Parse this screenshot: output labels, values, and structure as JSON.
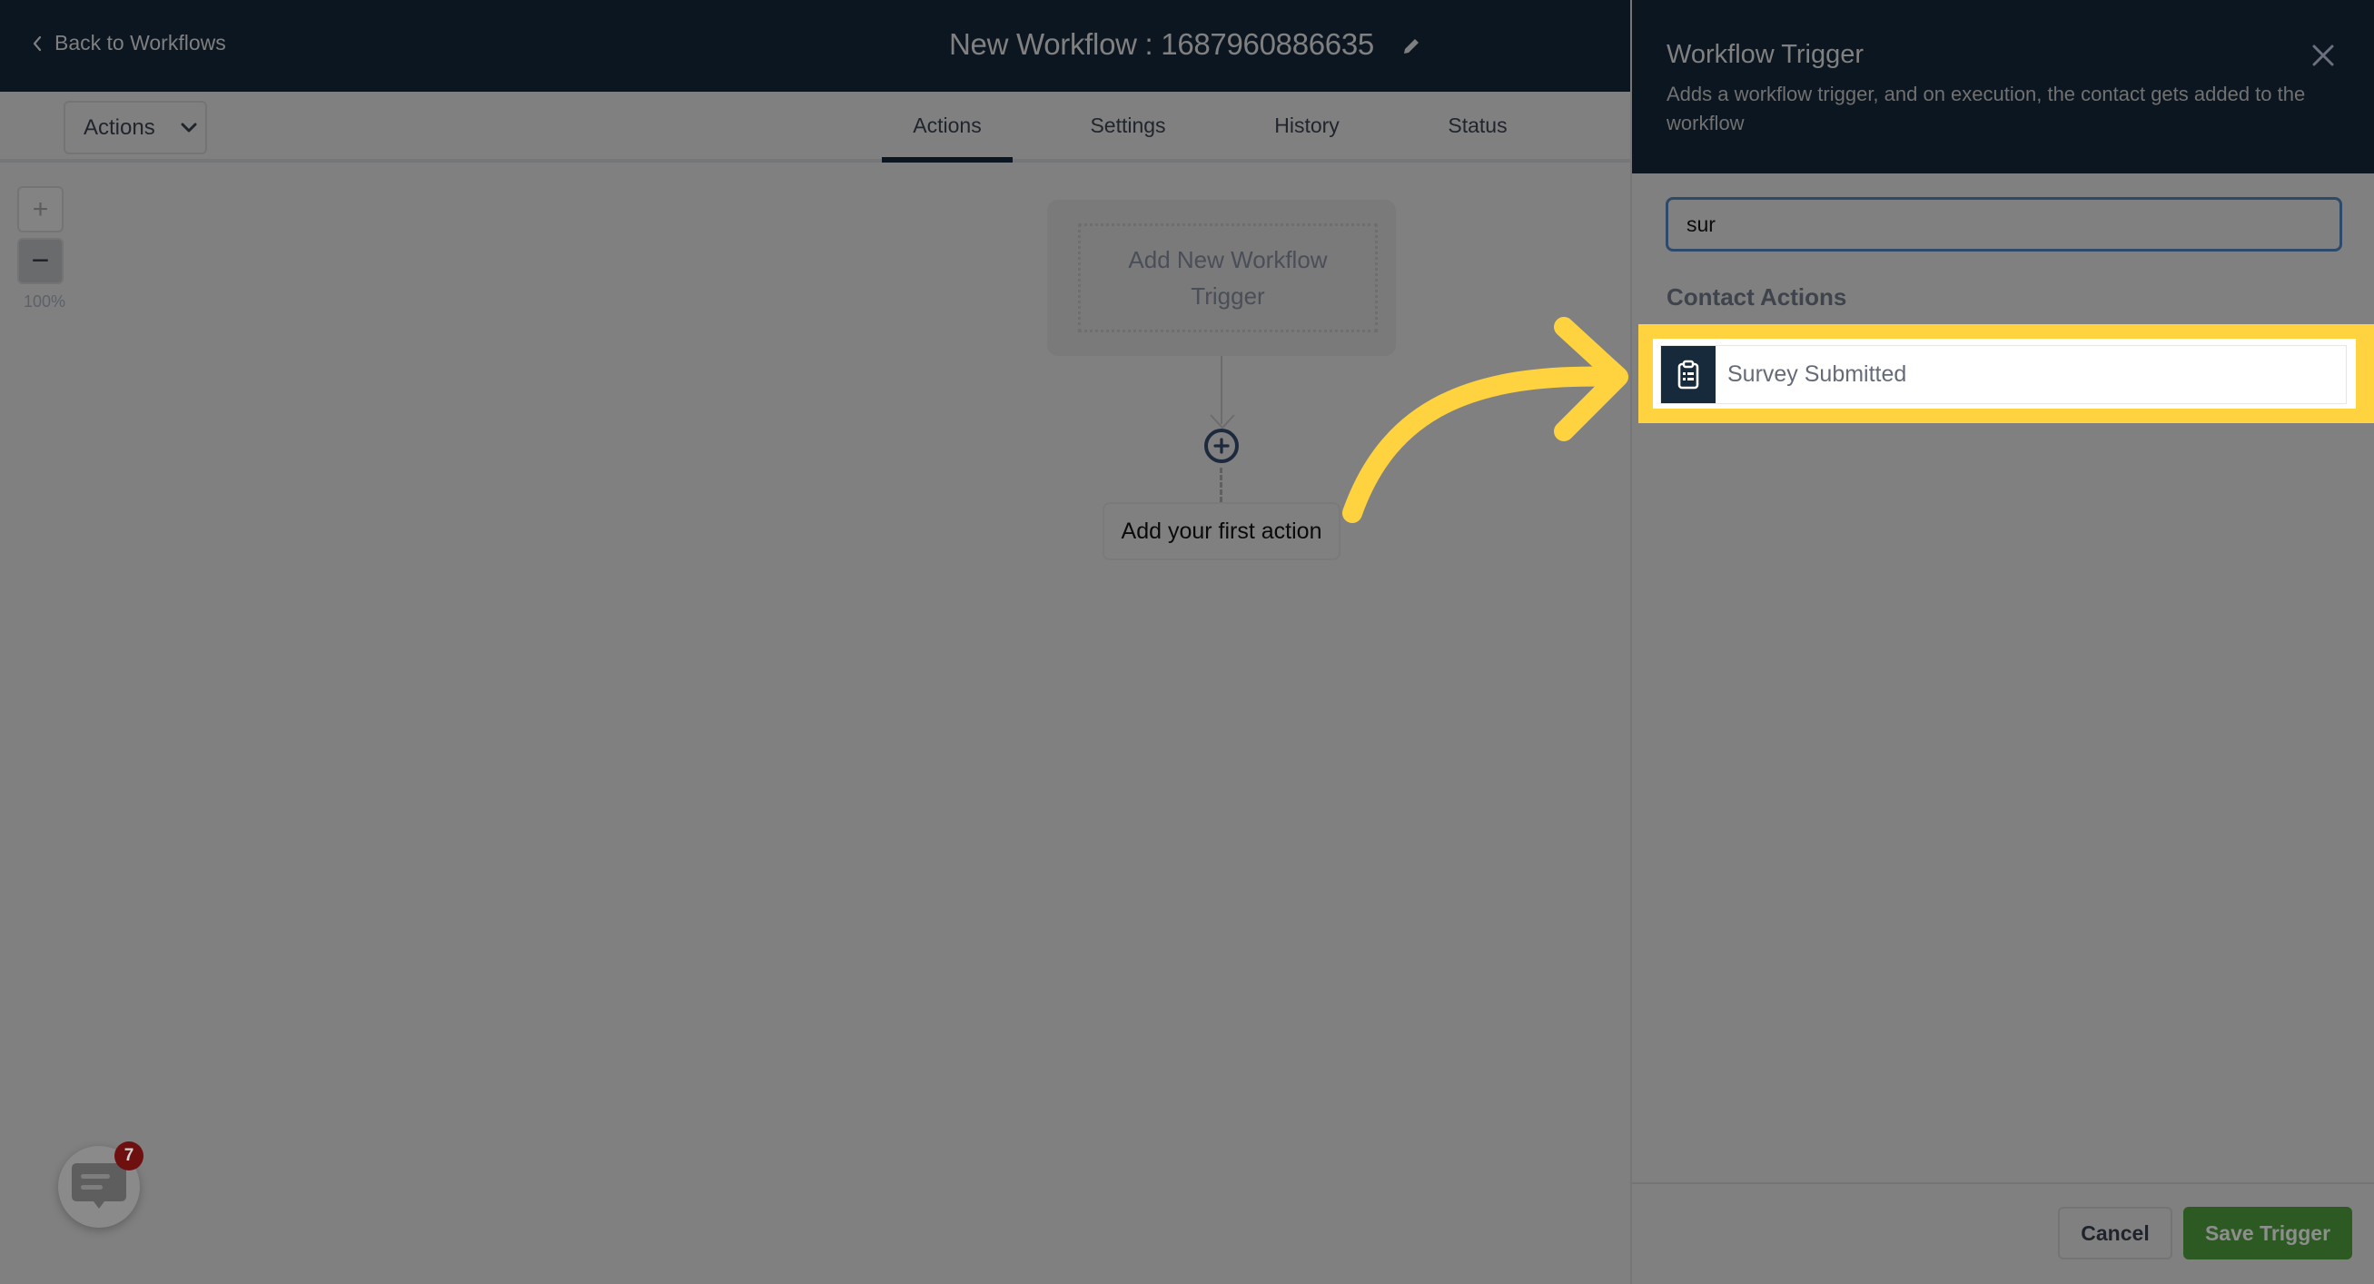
{
  "header": {
    "back_label": "Back to Workflows",
    "workflow_title": "New Workflow : 1687960886635",
    "edit_icon": "pencil-icon"
  },
  "toolbar": {
    "actions_dropdown": "Actions",
    "tabs": [
      {
        "label": "Actions",
        "active": true
      },
      {
        "label": "Settings",
        "active": false
      },
      {
        "label": "History",
        "active": false
      },
      {
        "label": "Status",
        "active": false
      }
    ]
  },
  "canvas": {
    "zoom_in": "+",
    "zoom_out": "−",
    "zoom_level": "100%",
    "trigger_placeholder": "Add New Workflow Trigger",
    "first_action": "Add your first action"
  },
  "chat": {
    "badge_count": "7"
  },
  "panel": {
    "title": "Workflow Trigger",
    "description": "Adds a workflow trigger, and on execution, the contact gets added to the workflow",
    "search_value": "sur",
    "section_title": "Contact Actions",
    "results": [
      {
        "label": "Survey Submitted",
        "icon": "clipboard-list-icon",
        "highlighted": true
      }
    ],
    "cancel_label": "Cancel",
    "save_label": "Save Trigger"
  },
  "colors": {
    "header_bg": "#0c1620",
    "overlay_gray": "#808080",
    "highlight_yellow": "#ffd23f",
    "save_green": "#2d5a22",
    "icon_tile": "#172a3b"
  }
}
